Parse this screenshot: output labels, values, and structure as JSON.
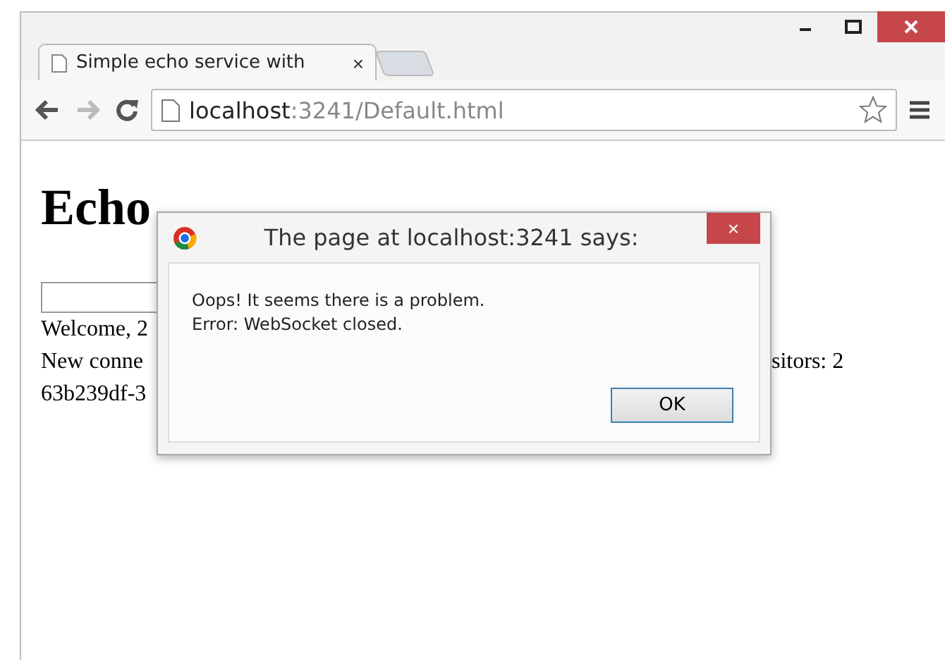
{
  "tab": {
    "title": "Simple echo service with",
    "close": "×"
  },
  "address": {
    "host": "localhost",
    "path": ":3241/Default.html"
  },
  "page": {
    "heading": "Echo",
    "lines": [
      {
        "left": "Welcome, 2"
      },
      {
        "left": "New conne",
        "right": "sitors: 2"
      },
      {
        "left": "63b239df-3"
      }
    ]
  },
  "dialog": {
    "title": "The page at localhost:3241 says:",
    "close": "×",
    "message": [
      "Oops! It seems there is a problem.",
      "Error: WebSocket closed."
    ],
    "button": "OK"
  }
}
